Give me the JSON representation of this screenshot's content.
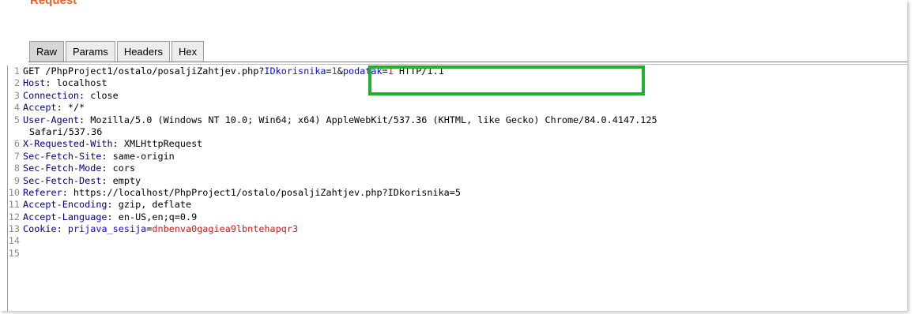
{
  "panel": {
    "title": "Request"
  },
  "tabs": [
    {
      "label": "Raw",
      "active": true
    },
    {
      "label": "Params",
      "active": false
    },
    {
      "label": "Headers",
      "active": false
    },
    {
      "label": "Hex",
      "active": false
    }
  ],
  "colors": {
    "title": "#e8602c",
    "header_name": "#00007d",
    "param_name": "#0b0bd8",
    "param_value": "#d11b1b",
    "highlight_box": "#22b02e"
  },
  "request": {
    "line1": {
      "num": "1",
      "method_path": "GET /PhpProject1/ostalo/posaljiZahtjev.php?",
      "p1_name": "IDkorisnika",
      "eq1": "=",
      "p1_value": "1",
      "amp": "&",
      "p2_name": "podatak",
      "eq2": "=",
      "p2_value": "1",
      "protocol": " HTTP/1.1"
    },
    "headers": [
      {
        "num": "2",
        "name": "Host",
        "value": " localhost"
      },
      {
        "num": "3",
        "name": "Connection",
        "value": " close"
      },
      {
        "num": "4",
        "name": "Accept",
        "value": " */*"
      },
      {
        "num": "5",
        "name": "User-Agent",
        "value": " Mozilla/5.0 (Windows NT 10.0; Win64; x64) AppleWebKit/537.36 (KHTML, like Gecko) Chrome/84.0.4147.125",
        "continuation": "Safari/537.36"
      },
      {
        "num": "6",
        "name": "X-Requested-With",
        "value": " XMLHttpRequest"
      },
      {
        "num": "7",
        "name": "Sec-Fetch-Site",
        "value": " same-origin"
      },
      {
        "num": "8",
        "name": "Sec-Fetch-Mode",
        "value": " cors"
      },
      {
        "num": "9",
        "name": "Sec-Fetch-Dest",
        "value": " empty"
      },
      {
        "num": "10",
        "name": "Referer",
        "value": " https://localhost/PhpProject1/ostalo/posaljiZahtjev.php?IDkorisnika=5"
      },
      {
        "num": "11",
        "name": "Accept-Encoding",
        "value": " gzip, deflate"
      },
      {
        "num": "12",
        "name": "Accept-Language",
        "value": " en-US,en;q=0.9"
      }
    ],
    "cookie": {
      "num": "13",
      "name": "Cookie",
      "sep": ": ",
      "cookie_name": "prijava_sesija",
      "eq": "=",
      "cookie_value": "dnbenva0gagiea9lbntehapqr3"
    },
    "empty_lines": [
      "14",
      "15"
    ]
  }
}
